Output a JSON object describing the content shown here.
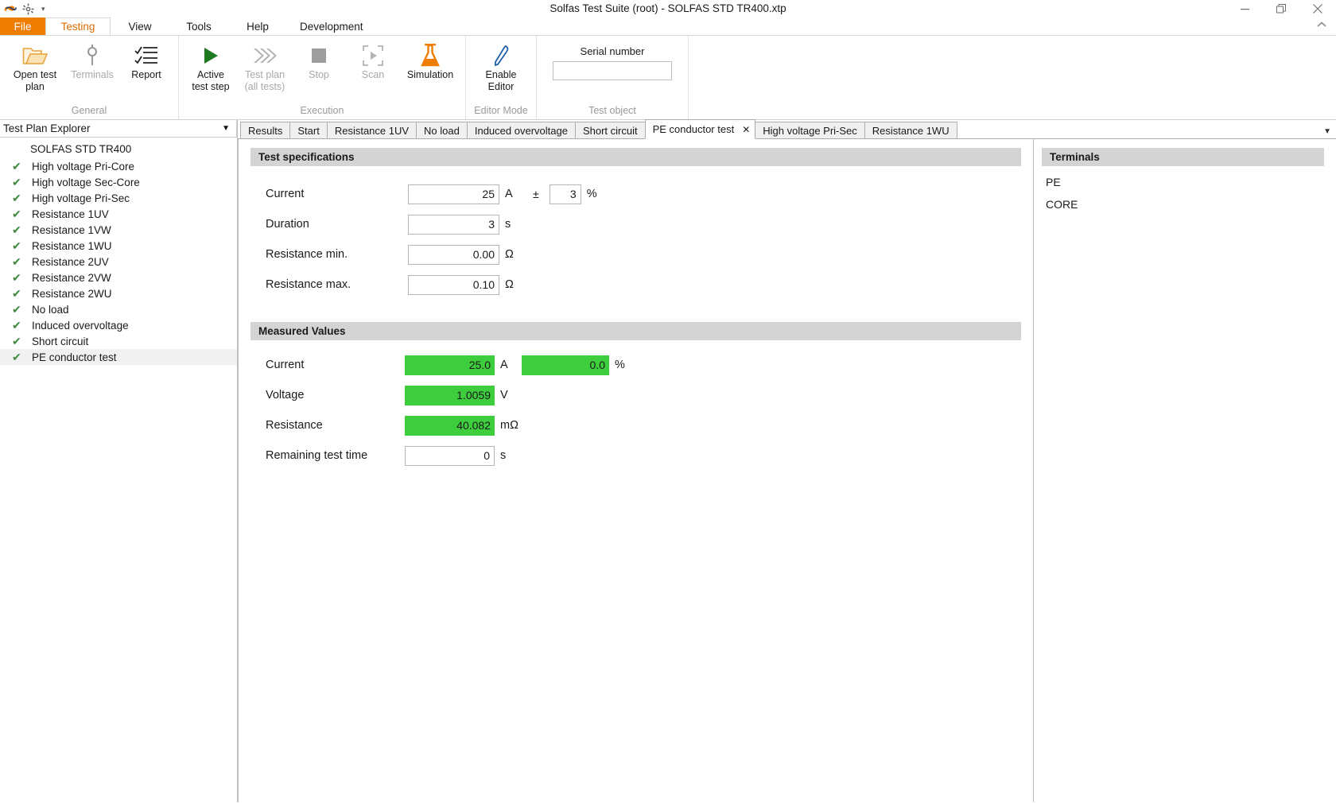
{
  "window": {
    "title": "Solfas Test Suite (root)  - SOLFAS STD TR400.xtp",
    "quick_access": [
      {
        "name": "app-logo-icon",
        "label": "Solfas"
      },
      {
        "name": "settings-gear-icon",
        "label": "Settings"
      },
      {
        "name": "qat-dropdown-icon",
        "label": "Customize Quick Access Toolbar"
      }
    ],
    "controls": [
      {
        "name": "minimize-button",
        "label": "Minimize"
      },
      {
        "name": "restore-button",
        "label": "Restore"
      },
      {
        "name": "close-button",
        "label": "Close"
      }
    ],
    "ribbon_collapse_label": "Collapse the Ribbon"
  },
  "ribbon": {
    "tabs": [
      {
        "label": "File",
        "active": false,
        "kind": "file"
      },
      {
        "label": "Testing",
        "active": true,
        "kind": "normal"
      },
      {
        "label": "View",
        "active": false,
        "kind": "normal"
      },
      {
        "label": "Tools",
        "active": false,
        "kind": "normal"
      },
      {
        "label": "Help",
        "active": false,
        "kind": "normal"
      },
      {
        "label": "Development",
        "active": false,
        "kind": "normal"
      }
    ],
    "groups": {
      "general": {
        "label": "General",
        "buttons": [
          {
            "label": "Open test\nplan",
            "icon": "folder-open-icon",
            "disabled": false
          },
          {
            "label": "Terminals",
            "icon": "terminals-icon",
            "disabled": true
          },
          {
            "label": "Report",
            "icon": "report-checklist-icon",
            "disabled": false
          }
        ]
      },
      "execution": {
        "label": "Execution",
        "buttons": [
          {
            "label": "Active\ntest step",
            "icon": "play-icon",
            "disabled": false
          },
          {
            "label": "Test plan",
            "sublabel": "(all tests)",
            "icon": "fast-forward-icon",
            "disabled": true
          },
          {
            "label": "Stop",
            "icon": "stop-square-icon",
            "disabled": true
          },
          {
            "label": "Scan",
            "icon": "scan-icon",
            "disabled": true
          },
          {
            "label": "Simulation",
            "icon": "flask-icon",
            "disabled": false
          }
        ]
      },
      "editor_mode": {
        "label": "Editor Mode",
        "buttons": [
          {
            "label": "Enable\nEditor",
            "icon": "pencil-icon",
            "disabled": false
          }
        ]
      },
      "test_object": {
        "label": "Test object",
        "serial_number_label": "Serial number",
        "serial_number_value": "",
        "serial_number_placeholder": ""
      }
    }
  },
  "sidebar": {
    "header": "Test Plan Explorer",
    "root": "SOLFAS STD TR400",
    "items": [
      {
        "label": "High voltage Pri-Core",
        "status": "pass",
        "selected": false
      },
      {
        "label": "High voltage Sec-Core",
        "status": "pass",
        "selected": false
      },
      {
        "label": "High voltage Pri-Sec",
        "status": "pass",
        "selected": false
      },
      {
        "label": "Resistance 1UV",
        "status": "pass",
        "selected": false
      },
      {
        "label": "Resistance 1VW",
        "status": "pass",
        "selected": false
      },
      {
        "label": "Resistance 1WU",
        "status": "pass",
        "selected": false
      },
      {
        "label": "Resistance 2UV",
        "status": "pass",
        "selected": false
      },
      {
        "label": "Resistance 2VW",
        "status": "pass",
        "selected": false
      },
      {
        "label": "Resistance 2WU",
        "status": "pass",
        "selected": false
      },
      {
        "label": "No load",
        "status": "pass",
        "selected": false
      },
      {
        "label": "Induced overvoltage",
        "status": "pass",
        "selected": false
      },
      {
        "label": "Short circuit",
        "status": "pass",
        "selected": false
      },
      {
        "label": "PE conductor test",
        "status": "pass",
        "selected": true
      }
    ]
  },
  "tabs": [
    {
      "label": "Results",
      "active": false,
      "closable": false
    },
    {
      "label": "Start",
      "active": false,
      "closable": false
    },
    {
      "label": "Resistance 1UV",
      "active": false,
      "closable": false
    },
    {
      "label": "No load",
      "active": false,
      "closable": false
    },
    {
      "label": "Induced overvoltage",
      "active": false,
      "closable": false
    },
    {
      "label": "Short circuit",
      "active": false,
      "closable": false
    },
    {
      "label": "PE conductor test",
      "active": true,
      "closable": true
    },
    {
      "label": "High voltage Pri-Sec",
      "active": false,
      "closable": false
    },
    {
      "label": "Resistance 1WU",
      "active": false,
      "closable": false
    }
  ],
  "test_specifications": {
    "title": "Test specifications",
    "rows": [
      {
        "label": "Current",
        "value": "25",
        "unit": "A",
        "tolerance_symbol": "±",
        "tolerance_value": "3",
        "tolerance_unit": "%"
      },
      {
        "label": "Duration",
        "value": "3",
        "unit": "s"
      },
      {
        "label": "Resistance min.",
        "value": "0.00",
        "unit": "Ω"
      },
      {
        "label": "Resistance max.",
        "value": "0.10",
        "unit": "Ω"
      }
    ]
  },
  "measured_values": {
    "title": "Measured Values",
    "ok_color": "#3dcd3d",
    "rows": [
      {
        "label": "Current",
        "value": "25.0",
        "unit": "A",
        "state": "ok",
        "second_value": "0.0",
        "second_unit": "%",
        "second_state": "ok"
      },
      {
        "label": "Voltage",
        "value": "1.0059",
        "unit": "V",
        "state": "ok"
      },
      {
        "label": "Resistance",
        "value": "40.082",
        "unit": "mΩ",
        "state": "ok"
      },
      {
        "label": "Remaining test time",
        "value": "0",
        "unit": "s",
        "state": "neutral"
      }
    ]
  },
  "terminals": {
    "title": "Terminals",
    "items": [
      "PE",
      "CORE"
    ]
  }
}
